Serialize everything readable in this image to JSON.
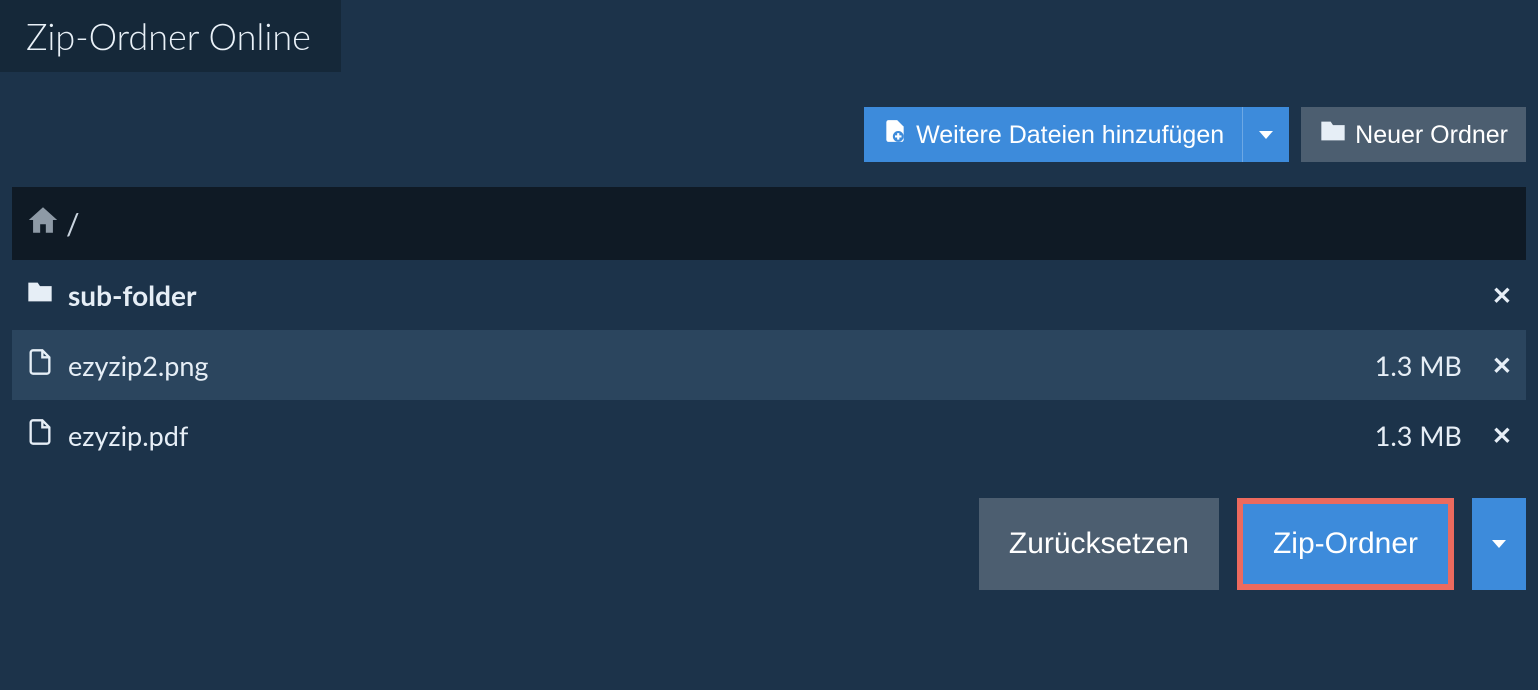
{
  "header": {
    "title": "Zip-Ordner Online"
  },
  "toolbar": {
    "add_files_label": "Weitere Dateien hinzufügen",
    "new_folder_label": "Neuer Ordner"
  },
  "breadcrumb": {
    "separator": "/"
  },
  "items": [
    {
      "type": "folder",
      "name": "sub-folder",
      "size": ""
    },
    {
      "type": "file",
      "name": "ezyzip2.png",
      "size": "1.3 MB"
    },
    {
      "type": "file",
      "name": "ezyzip.pdf",
      "size": "1.3 MB"
    }
  ],
  "footer": {
    "reset_label": "Zurücksetzen",
    "zip_label": "Zip-Ordner"
  }
}
